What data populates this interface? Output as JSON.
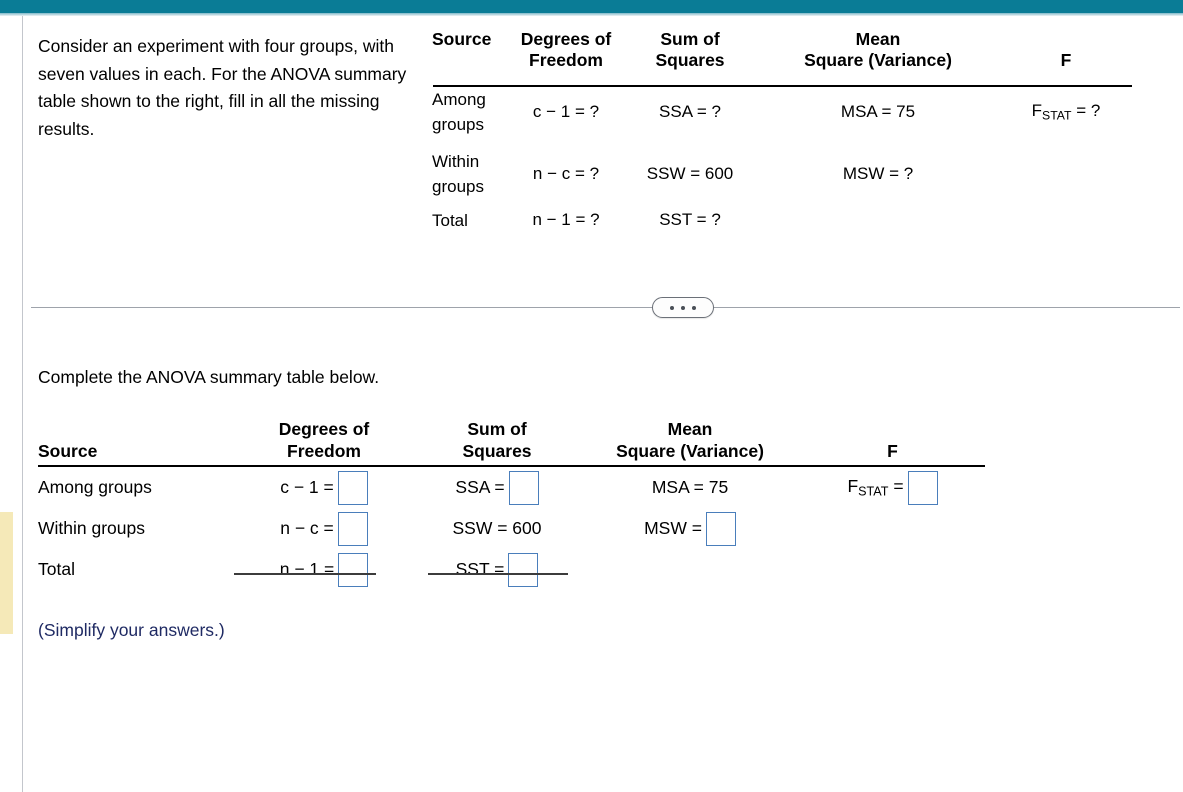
{
  "window": {
    "accent_teal": "#0a7c96",
    "answer_box_border": "#4a7ebb",
    "hint_text_color": "#1f2a63"
  },
  "prompt": {
    "text": "Consider an experiment with four groups, with seven values in each. For the ANOVA summary table shown to the right, fill in all the missing results."
  },
  "reference_table": {
    "headers": {
      "source": "Source",
      "degrees_line1": "Degrees of",
      "degrees_line2": "Freedom",
      "sum_line1": "Sum of",
      "sum_line2": "Squares",
      "mean_line1": "Mean",
      "mean_line2": "Square (Variance)",
      "f": "F"
    },
    "rows": [
      {
        "source_line1": "Among",
        "source_line2": "groups",
        "df": "c − 1 = ?",
        "ss": "SSA = ?",
        "ms": "MSA = 75",
        "f_prefix": "F",
        "f_sub": "STAT",
        "f_suffix": " = ?"
      },
      {
        "source_line1": "Within",
        "source_line2": "groups",
        "df": "n − c = ?",
        "ss": "SSW = 600",
        "ms": "MSW = ?",
        "f_prefix": "",
        "f_sub": "",
        "f_suffix": ""
      },
      {
        "source_line1": "Total",
        "source_line2": "",
        "df": "n − 1 = ?",
        "ss": "SST = ?",
        "ms": "",
        "f_prefix": "",
        "f_sub": "",
        "f_suffix": ""
      }
    ]
  },
  "divider": {
    "ellipsis_label": "..."
  },
  "section": {
    "title": "Complete the ANOVA summary table below."
  },
  "answer_table": {
    "headers": {
      "source": "Source",
      "degrees_line1": "Degrees of",
      "degrees_line2": "Freedom",
      "sum_line1": "Sum of",
      "sum_line2": "Squares",
      "mean_line1": "Mean",
      "mean_line2": "Square (Variance)",
      "f": "F"
    },
    "rows": [
      {
        "source": "Among groups",
        "df_label": "c − 1 =",
        "df_value": "",
        "df_has_input": true,
        "ss_label": "SSA =",
        "ss_value": "",
        "ss_has_input": true,
        "ms_label": "MSA = 75",
        "ms_value": "",
        "ms_has_input": false,
        "f_prefix": "F",
        "f_sub": "STAT",
        "f_suffix": " =",
        "f_value": "",
        "f_has_input": true
      },
      {
        "source": "Within groups",
        "df_label": "n − c =",
        "df_value": "",
        "df_has_input": true,
        "ss_label": "SSW = 600",
        "ss_value": "",
        "ss_has_input": false,
        "ms_label": "MSW =",
        "ms_value": "",
        "ms_has_input": true,
        "f_prefix": "",
        "f_sub": "",
        "f_suffix": "",
        "f_value": "",
        "f_has_input": false
      },
      {
        "source": "Total",
        "df_label": "n − 1 =",
        "df_value": "",
        "df_has_input": true,
        "ss_label": "SST =",
        "ss_value": "",
        "ss_has_input": true,
        "ms_label": "",
        "ms_value": "",
        "ms_has_input": false,
        "f_prefix": "",
        "f_sub": "",
        "f_suffix": "",
        "f_value": "",
        "f_has_input": false
      }
    ],
    "note": "(Simplify your answers.)"
  }
}
